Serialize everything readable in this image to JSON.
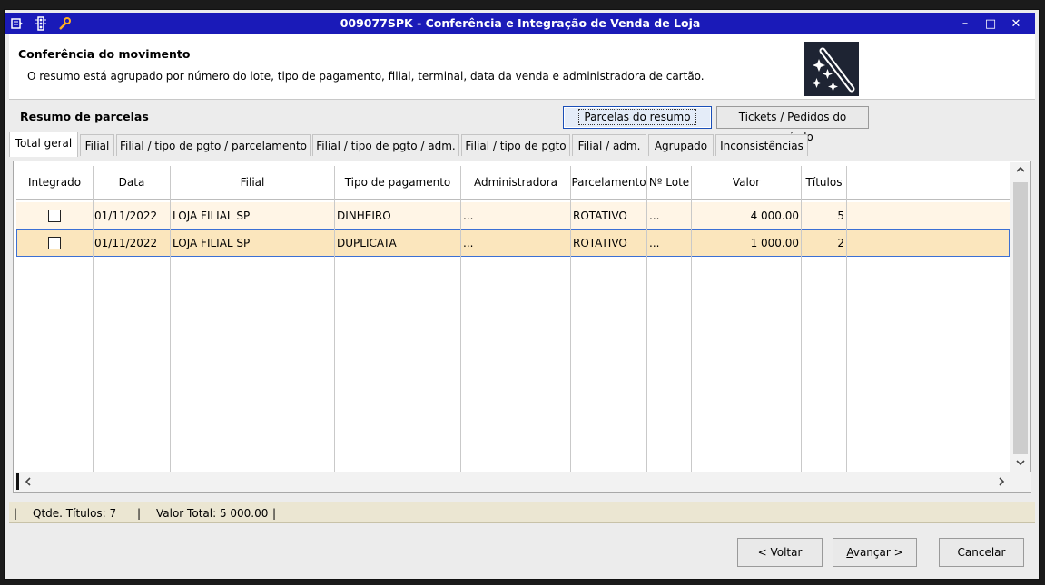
{
  "window": {
    "title": "009077SPK - Conferência e Integração de Venda de Loja",
    "controls": {
      "minimize": "–",
      "maximize": "□",
      "close": "✕"
    }
  },
  "header": {
    "title": "Conferência do movimento",
    "description": "O resumo está agrupado por número do lote, tipo de pagamento, filial, terminal, data da venda e administradora de cartão."
  },
  "section": {
    "title": "Resumo de parcelas",
    "buttons": {
      "parcelas": "Parcelas do resumo",
      "tickets": "Tickets / Pedidos do período"
    }
  },
  "tabs": [
    "Total geral",
    "Filial",
    "Filial / tipo de pgto / parcelamento",
    "Filial / tipo de pgto / adm.",
    "Filial / tipo de pgto",
    "Filial / adm.",
    "Agrupado",
    "Inconsistências"
  ],
  "table": {
    "columns": [
      "Integrado",
      "Data",
      "Filial",
      "Tipo de pagamento",
      "Administradora",
      "Parcelamento",
      "Nº Lote",
      "Valor",
      "Títulos"
    ],
    "rows": [
      {
        "integrado": false,
        "data": "01/11/2022",
        "filial": "LOJA FILIAL SP",
        "tipo": "DINHEIRO",
        "adm": "...",
        "parcelamento": "ROTATIVO",
        "lote": "...",
        "valor": "4 000.00",
        "titulos": "5"
      },
      {
        "integrado": false,
        "data": "01/11/2022",
        "filial": "LOJA FILIAL SP",
        "tipo": "DUPLICATA",
        "adm": "...",
        "parcelamento": "ROTATIVO",
        "lote": "...",
        "valor": "1 000.00",
        "titulos": "2"
      }
    ]
  },
  "status": {
    "sep": "|",
    "qtde": "Qtde. Títulos:  7",
    "valor": "Valor Total:  5 000.00"
  },
  "footer": {
    "back": "< Voltar",
    "next": "Avançar >",
    "cancel": "Cancelar"
  },
  "colors": {
    "titlebar": "#1a1ab8",
    "row_odd": "#fff5e6",
    "row_selected": "#fbe6bd",
    "statusbar": "#ebe6d2"
  }
}
